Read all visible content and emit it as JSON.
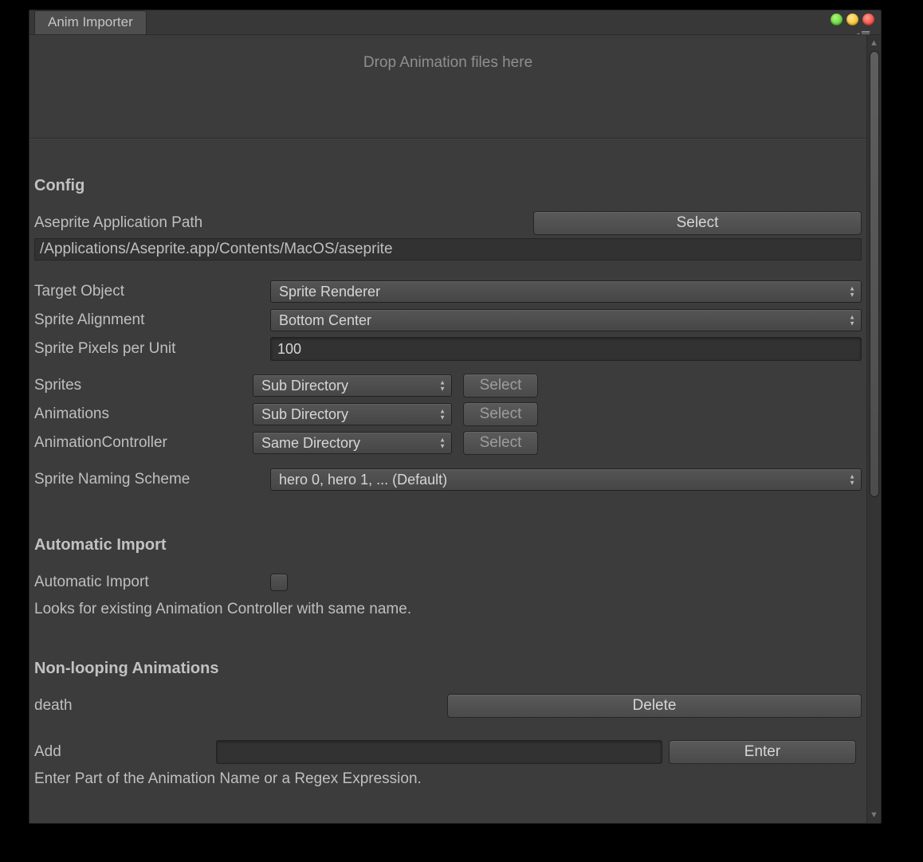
{
  "tab_title": "Anim Importer",
  "dropzone_text": "Drop Animation files here",
  "config": {
    "heading": "Config",
    "aseprite_path_label": "Aseprite Application Path",
    "aseprite_select_btn": "Select",
    "aseprite_path_value": "/Applications/Aseprite.app/Contents/MacOS/aseprite",
    "target_object_label": "Target Object",
    "target_object_value": "Sprite Renderer",
    "sprite_alignment_label": "Sprite Alignment",
    "sprite_alignment_value": "Bottom Center",
    "ppu_label": "Sprite Pixels per Unit",
    "ppu_value": "100",
    "sprites_label": "Sprites",
    "sprites_value": "Sub Directory",
    "sprites_select_btn": "Select",
    "animations_label": "Animations",
    "animations_value": "Sub Directory",
    "animations_select_btn": "Select",
    "animcontroller_label": "AnimationController",
    "animcontroller_value": "Same Directory",
    "animcontroller_select_btn": "Select",
    "naming_scheme_label": "Sprite Naming Scheme",
    "naming_scheme_value": "hero 0, hero 1, ... (Default)"
  },
  "auto_import": {
    "heading": "Automatic Import",
    "checkbox_label": "Automatic Import",
    "checkbox_checked": false,
    "help_text": "Looks for existing Animation Controller with same name."
  },
  "nonloop": {
    "heading": "Non-looping Animations",
    "items": [
      {
        "name": "death",
        "delete_btn": "Delete"
      }
    ],
    "add_label": "Add",
    "add_value": "",
    "enter_btn": "Enter",
    "help_text": "Enter Part of the Animation Name or a Regex Expression."
  }
}
